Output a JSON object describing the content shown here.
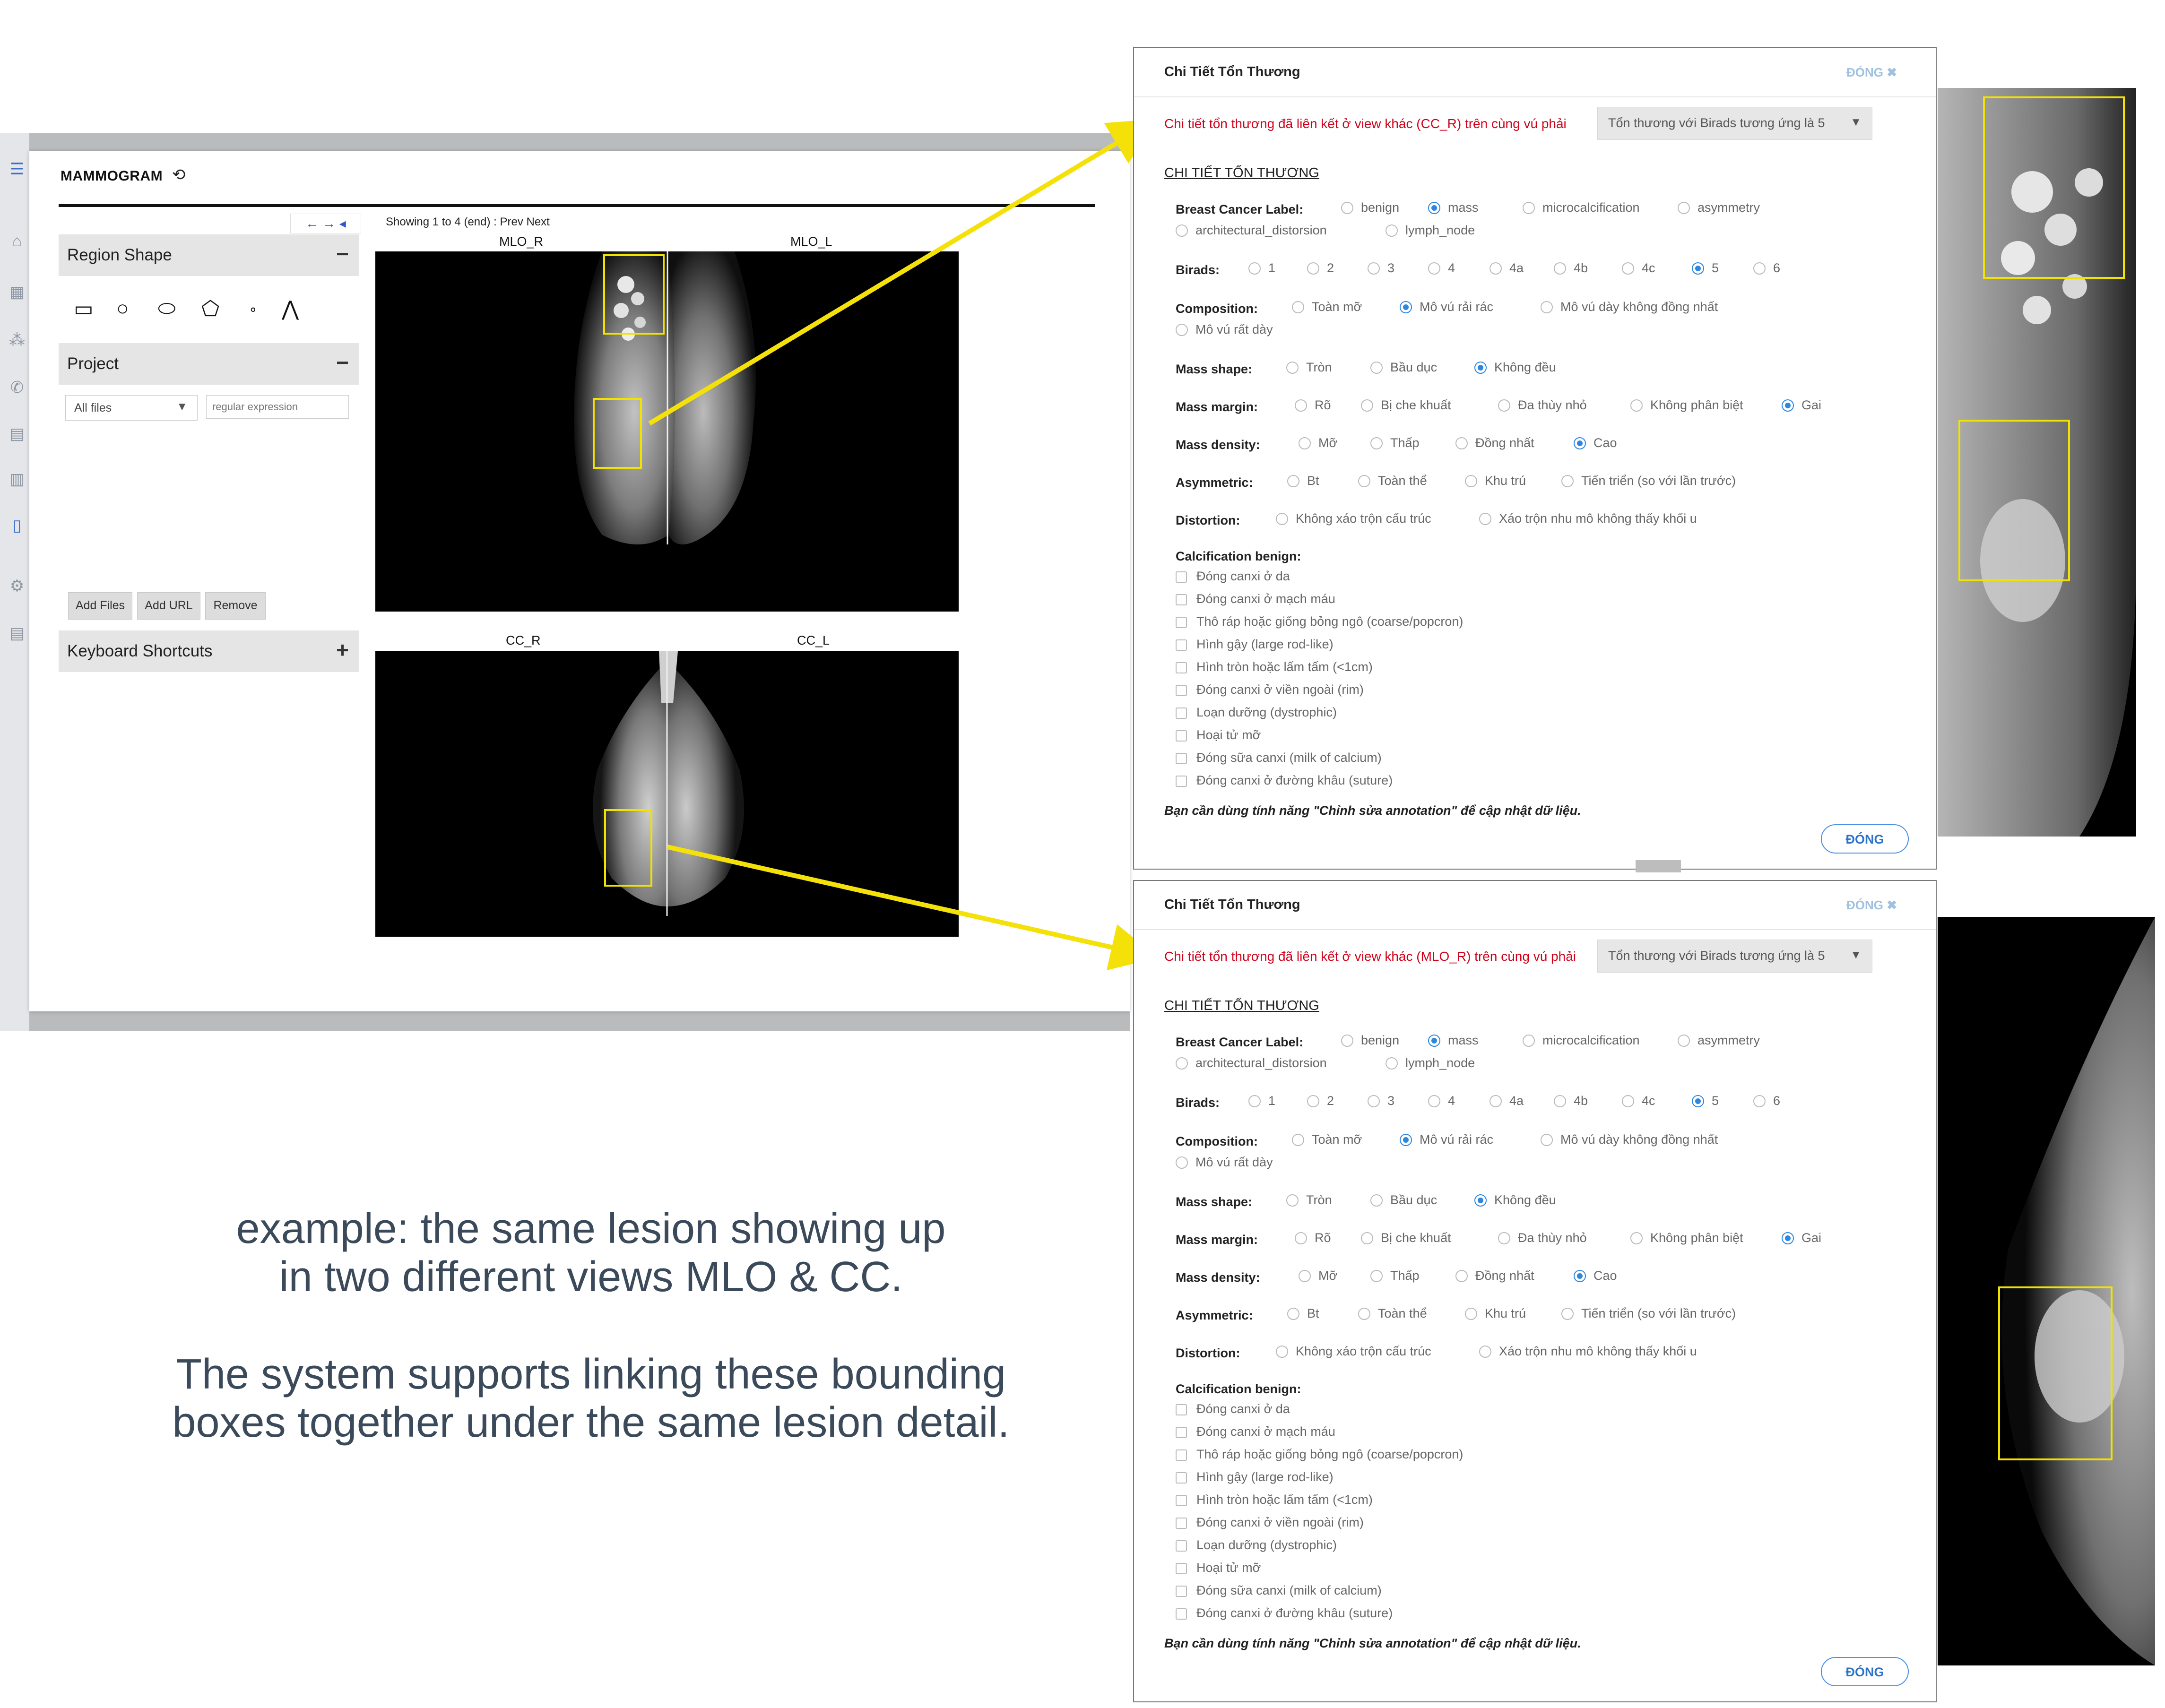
{
  "app": {
    "title": "MAMMOGRAM",
    "refresh_icon": "refresh-icon",
    "region_shape_label": "Region Shape",
    "project_label": "Project",
    "file_filter": "All files",
    "regex_placeholder": "regular expression",
    "add_files": "Add Files",
    "add_url": "Add URL",
    "remove": "Remove",
    "keyboard_shortcuts": "Keyboard Shortcuts",
    "minus": "−",
    "plus": "+",
    "nav_arrows": "← → ◂",
    "showing": "Showing 1 to 4 (end) :  Prev  Next",
    "views": {
      "mlo_r": "MLO_R",
      "mlo_l": "MLO_L",
      "cc_r": "CC_R",
      "cc_l": "CC_L"
    }
  },
  "dialogs": [
    {
      "title": "Chi Tiết Tổn Thương",
      "close_top": "ĐÓNG ✖",
      "linked_text": "Chi tiết tổn thương đã liên kết ở view khác (CC_R) trên cùng vú phải",
      "select_value": "Tổn thương với Birads tương ứng là 5",
      "section": "CHI TIẾT TỔN THƯƠNG",
      "note": "Bạn cần dùng tính năng \"Chỉnh sửa annotation\" để cập nhật dữ liệu.",
      "button": "ĐÓNG"
    },
    {
      "title": "Chi Tiết Tổn Thương",
      "close_top": "ĐÓNG ✖",
      "linked_text": "Chi tiết tổn thương đã liên kết ở view khác (MLO_R) trên cùng vú phải",
      "select_value": "Tổn thương với Birads tương ứng là 5",
      "section": "CHI TIẾT TỔN THƯƠNG",
      "note": "Bạn cần dùng tính năng \"Chỉnh sửa annotation\" để cập nhật dữ liệu.",
      "button": "ĐÓNG"
    }
  ],
  "form": {
    "labels": {
      "label": "Breast Cancer Label:",
      "birads": "Birads:",
      "composition": "Composition:",
      "mass_shape": "Mass shape:",
      "mass_margin": "Mass margin:",
      "mass_density": "Mass density:",
      "asymmetric": "Asymmetric:",
      "distortion": "Distortion:",
      "calcification": "Calcification benign:"
    },
    "label_options": [
      "benign",
      "mass",
      "microcalcification",
      "asymmetry",
      "architectural_distorsion",
      "lymph_node"
    ],
    "birads_options": [
      "1",
      "2",
      "3",
      "4",
      "4a",
      "4b",
      "4c",
      "5",
      "6"
    ],
    "composition_options": [
      "Toàn mỡ",
      "Mô vú rải rác",
      "Mô vú dày không đồng nhất",
      "Mô vú rất dày"
    ],
    "mass_shape_options": [
      "Tròn",
      "Bầu dục",
      "Không đều"
    ],
    "mass_margin_options": [
      "Rõ",
      "Bị che khuất",
      "Đa thùy nhỏ",
      "Không phân biệt",
      "Gai"
    ],
    "mass_density_options": [
      "Mỡ",
      "Thấp",
      "Đồng nhất",
      "Cao"
    ],
    "asymmetric_options": [
      "Bt",
      "Toàn thể",
      "Khu trú",
      "Tiến triển (so với lần trước)"
    ],
    "distortion_options": [
      "Không xáo trộn cấu trúc",
      "Xáo trộn nhu mô không thấy khối u"
    ],
    "calcification_options": [
      "Đóng canxi ở da",
      "Đóng canxi ở mạch máu",
      "Thô ráp hoặc giống bỏng ngô (coarse/popcron)",
      "Hình gậy (large rod-like)",
      "Hình tròn hoặc lấm tấm (<1cm)",
      "Đóng canxi ở viền ngoài (rim)",
      "Loạn dưỡng (dystrophic)",
      "Hoại tử mỡ",
      "Đóng sữa canxi (milk of calcium)",
      "Đóng canxi ở đường khâu (suture)"
    ],
    "selected": {
      "label": "mass",
      "birads": "5",
      "composition": "Mô vú rải rác",
      "mass_shape": "Không đều",
      "mass_margin": "Gai",
      "mass_density": "Cao"
    }
  },
  "caption": {
    "line1": "example: the same lesion showing up",
    "line2": "in two different views MLO & CC.",
    "line3": "The system supports linking these bounding",
    "line4": "boxes together under the same lesion detail."
  },
  "colors": {
    "accent_blue": "#2d86e0",
    "warning_red": "#d0021b",
    "bbox_yellow": "#f2e200",
    "link_arrow": "#f5e10a"
  }
}
